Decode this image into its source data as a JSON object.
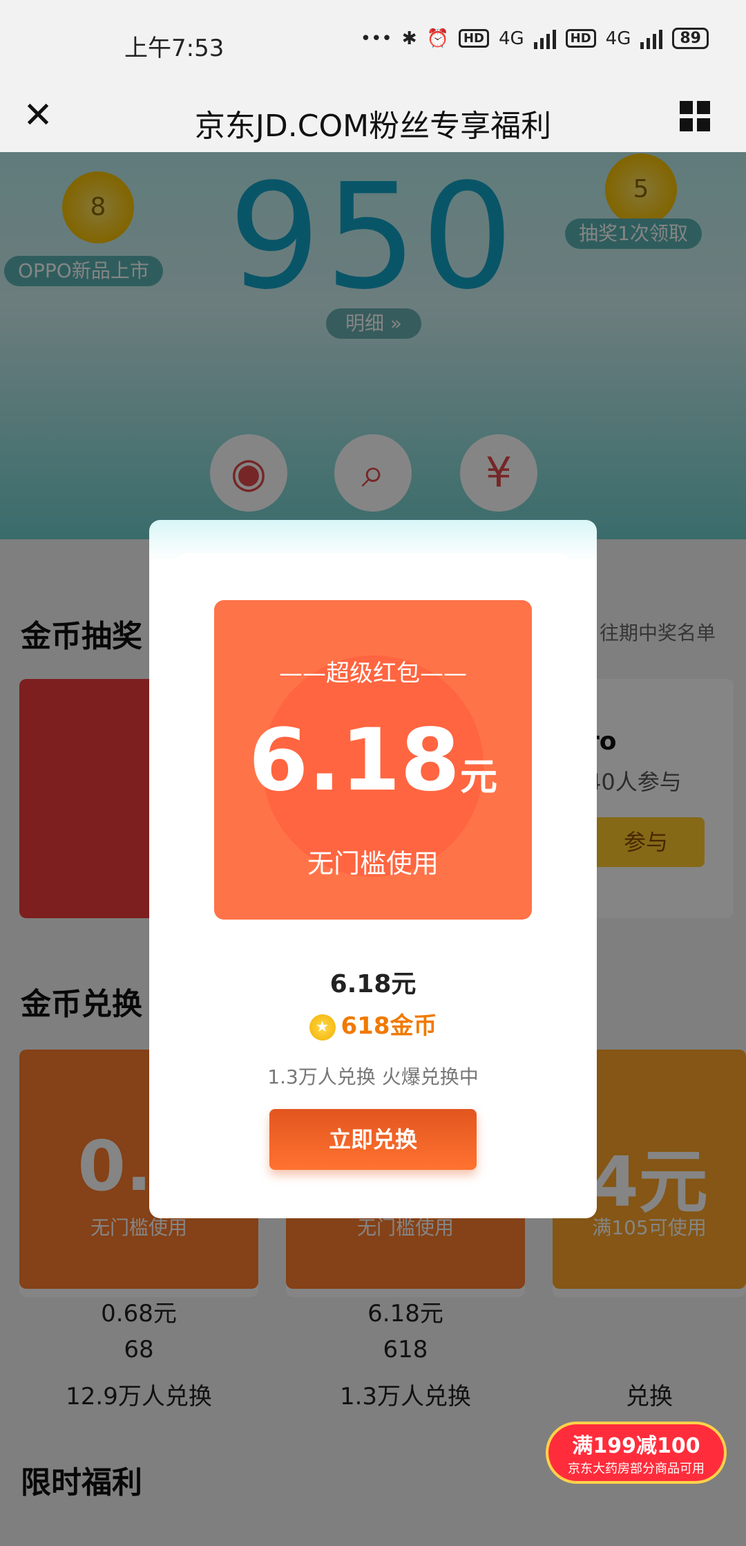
{
  "status_bar": {
    "time": "上午7:53",
    "signal_label": "4G",
    "hd_label": "HD",
    "battery": "89"
  },
  "nav": {
    "title": "京东JD.COM粉丝专享福利"
  },
  "hero": {
    "score": "950",
    "detail_label": "明细 »",
    "left_coin": "8",
    "left_label": "OPPO新品上市",
    "right_coin": "5",
    "right_label": "抽奖1次领取"
  },
  "lottery": {
    "title": "金币抽奖",
    "right_link": "往期中奖名单",
    "card_right": {
      "name_tail": "ro",
      "participants": "40人参与",
      "button": "参与"
    }
  },
  "exchange": {
    "title": "金币兑换",
    "cards": [
      {
        "value": "0.6",
        "use": "无门槛使用",
        "price": "0.68元",
        "coins": "68",
        "people": "12.9万人兑换"
      },
      {
        "value": "",
        "use": "无门槛使用",
        "price": "6.18元",
        "coins": "618",
        "people": "1.3万人兑换"
      },
      {
        "value": "4元",
        "use": "满105可使用",
        "price": "",
        "coins": "",
        "people": "兑换"
      }
    ]
  },
  "ad": {
    "big": "满199减100",
    "small": "京东大药房部分商品可用"
  },
  "bottom_title": "限时福利",
  "modal": {
    "coupon_label": "——超级红包——",
    "amount": "6.18",
    "unit": "元",
    "coupon_use": "无门槛使用",
    "price": "6.18元",
    "coins": "618金币",
    "people": "1.3万人兑换 火爆兑换中",
    "button": "立即兑换"
  },
  "colors": {
    "accent": "#ff7348",
    "teal": "#46c2d1",
    "button": "#e2561f"
  }
}
